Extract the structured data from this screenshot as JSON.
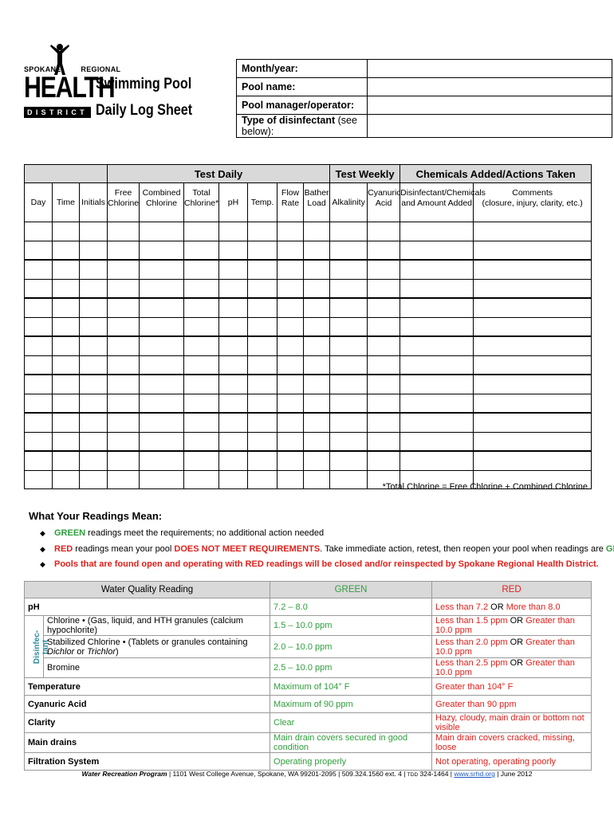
{
  "logo": {
    "top_left": "SPOKANE",
    "top_right": "REGIONAL",
    "main": "HEALTH",
    "bottom": "DISTRICT"
  },
  "title": {
    "line1": "Swimming Pool",
    "line2": "Daily Log Sheet"
  },
  "info_fields": [
    {
      "label": "Month/year:",
      "note": "",
      "value": ""
    },
    {
      "label": "Pool name:",
      "note": "",
      "value": ""
    },
    {
      "label": "Pool manager/operator:",
      "note": "",
      "value": ""
    },
    {
      "label": "Type of disinfectant",
      "note": " (see below):",
      "value": ""
    }
  ],
  "log_table": {
    "groups": {
      "test_daily": "Test Daily",
      "test_weekly": "Test Weekly",
      "chemicals": "Chemicals Added/Actions Taken"
    },
    "columns": [
      {
        "line1": "Day",
        "line2": ""
      },
      {
        "line1": "Time",
        "line2": ""
      },
      {
        "line1": "Initials",
        "line2": ""
      },
      {
        "line1": "Free",
        "line2": "Chlorine"
      },
      {
        "line1": "Combined",
        "line2": "Chlorine"
      },
      {
        "line1": "Total",
        "line2": "Chlorine*"
      },
      {
        "line1": "pH",
        "line2": ""
      },
      {
        "line1": "Temp.",
        "line2": ""
      },
      {
        "line1": "Flow",
        "line2": "Rate"
      },
      {
        "line1": "Bather",
        "line2": "Load"
      },
      {
        "line1": "Alkalinity",
        "line2": ""
      },
      {
        "line1": "Cyanuric",
        "line2": "Acid"
      },
      {
        "line1": "Disinfectant/Chemicals",
        "line2": "and Amount Added"
      },
      {
        "line1": "Comments",
        "line2": "(closure, injury, clarity, etc.)"
      }
    ],
    "row_count": 14
  },
  "footnote": "*Total Chlorine = Free Chlorine + Combined Chlorine",
  "readings": {
    "title": "What Your Readings Mean:",
    "bullet1": {
      "green": "GREEN",
      "text": " readings meet the requirements; no additional action needed"
    },
    "bullet2": {
      "red": "RED",
      "text1": " readings mean your pool ",
      "bold_red": "DOES NOT MEET REQUIREMENTS",
      "text2": ". Take immediate action, retest, then reopen your pool when readings are ",
      "green": "GREEN",
      "end": "."
    },
    "bullet3": "Pools that are found open and operating with RED readings will be closed and/or reinspected by Spokane Regional Health District."
  },
  "quality_table": {
    "headers": {
      "reading": "Water Quality Reading",
      "green": "GREEN",
      "red": "RED"
    },
    "side_label": "Disinfec-tant",
    "rows": {
      "ph": {
        "label": "pH",
        "green": "7.2 – 8.0",
        "red_a": "Less than 7.2",
        "or": " OR ",
        "red_b": "More than 8.0"
      },
      "chlorine": {
        "label": "Chlorine • (Gas, liquid, and HTH granules (calcium hypochlorite)",
        "green": "1.5 – 10.0 ppm",
        "red_a": "Less than 1.5 ppm",
        "or": " OR ",
        "red_b": "Greater than 10.0 ppm"
      },
      "stabilized": {
        "label_a": "Stabilized Chlorine • (Tablets or granules containing ",
        "label_i1": "Dichlor",
        "label_b": " or ",
        "label_i2": "Trichlor",
        "label_c": ")",
        "green": "2.0 – 10.0 ppm",
        "red_a": "Less than 2.0 ppm",
        "or": " OR ",
        "red_b": "Greater than 10.0 ppm"
      },
      "bromine": {
        "label": "Bromine",
        "green": "2.5 – 10.0 ppm",
        "red_a": "Less than 2.5 ppm",
        "or": " OR ",
        "red_b": "Greater than 10.0 ppm"
      },
      "temperature": {
        "label": "Temperature",
        "green": "Maximum of 104° F",
        "red": "Greater than 104° F"
      },
      "cyanuric": {
        "label": "Cyanuric Acid",
        "green": "Maximum of 90 ppm",
        "red": "Greater than 90 ppm"
      },
      "clarity": {
        "label": "Clarity",
        "green": "Clear",
        "red": "Hazy, cloudy, main drain or bottom not visible"
      },
      "drains": {
        "label": "Main drains",
        "green": "Main drain covers secured in good condition",
        "red": "Main drain covers cracked, missing, loose"
      },
      "filtration": {
        "label": "Filtration System",
        "green": "Operating properly",
        "red": "Not operating, operating poorly"
      }
    }
  },
  "footer": {
    "program": "Water Recreation Program",
    "address": " | 1101 West College Avenue, Spokane, WA 99201-2095 | 509.324.1560 ext. 4 | ",
    "tdd_label": "TDD",
    "tdd": " 324-1464 | ",
    "link": "www.srhd.org",
    "date": " | June 2012"
  },
  "colors": {
    "green": "#2e9e3c",
    "red": "#e0201b",
    "header_gray": "#d9d9d9"
  }
}
